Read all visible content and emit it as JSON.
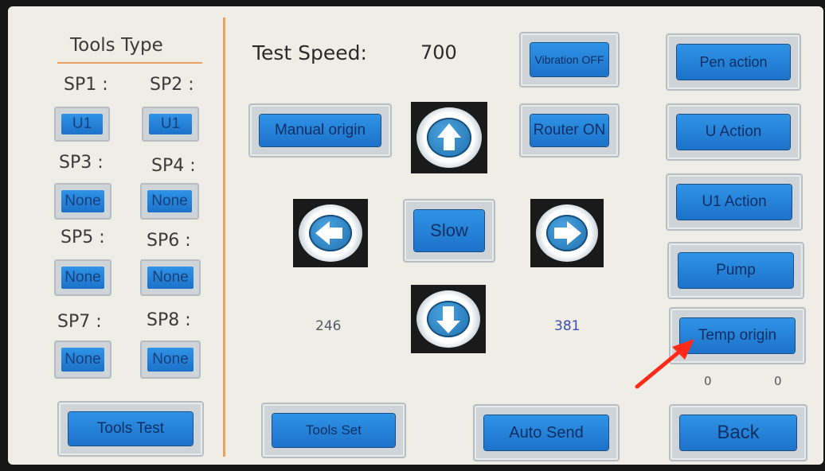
{
  "left_panel": {
    "title": "Tools Type",
    "slots": [
      {
        "label": "SP1 :",
        "value": "U1"
      },
      {
        "label": "SP2 :",
        "value": "U1"
      },
      {
        "label": "SP3 :",
        "value": "None"
      },
      {
        "label": "SP4 :",
        "value": "None"
      },
      {
        "label": "SP5 :",
        "value": "None"
      },
      {
        "label": "SP6 :",
        "value": "None"
      },
      {
        "label": "SP7 :",
        "value": "None"
      },
      {
        "label": "SP8 :",
        "value": "None"
      }
    ],
    "tools_test": "Tools Test"
  },
  "main": {
    "test_speed_label": "Test Speed:",
    "test_speed_value": "700",
    "vibration_btn": "Vibration OFF",
    "manual_origin_btn": "Manual origin",
    "router_btn": "Router ON",
    "slow_btn": "Slow",
    "coord_left": "246",
    "coord_right": "381",
    "tools_set_btn": "Tools Set",
    "auto_send_btn": "Auto Send"
  },
  "right_panel": {
    "pen_action": "Pen action",
    "u_action": "U Action",
    "u1_action": "U1 Action",
    "pump": "Pump",
    "temp_origin": "Temp origin",
    "val_a": "0",
    "val_b": "0",
    "back": "Back"
  },
  "icons": {
    "up": "arrow-up-icon",
    "down": "arrow-down-icon",
    "left": "arrow-left-icon",
    "right": "arrow-right-icon",
    "pointer": "red-pointer-arrow-icon"
  },
  "colors": {
    "button_blue": "#1f7fd6",
    "screen_bg": "#eeeee6",
    "divider_orange": "#e8a060",
    "annotation_red": "#ff2a1a"
  }
}
